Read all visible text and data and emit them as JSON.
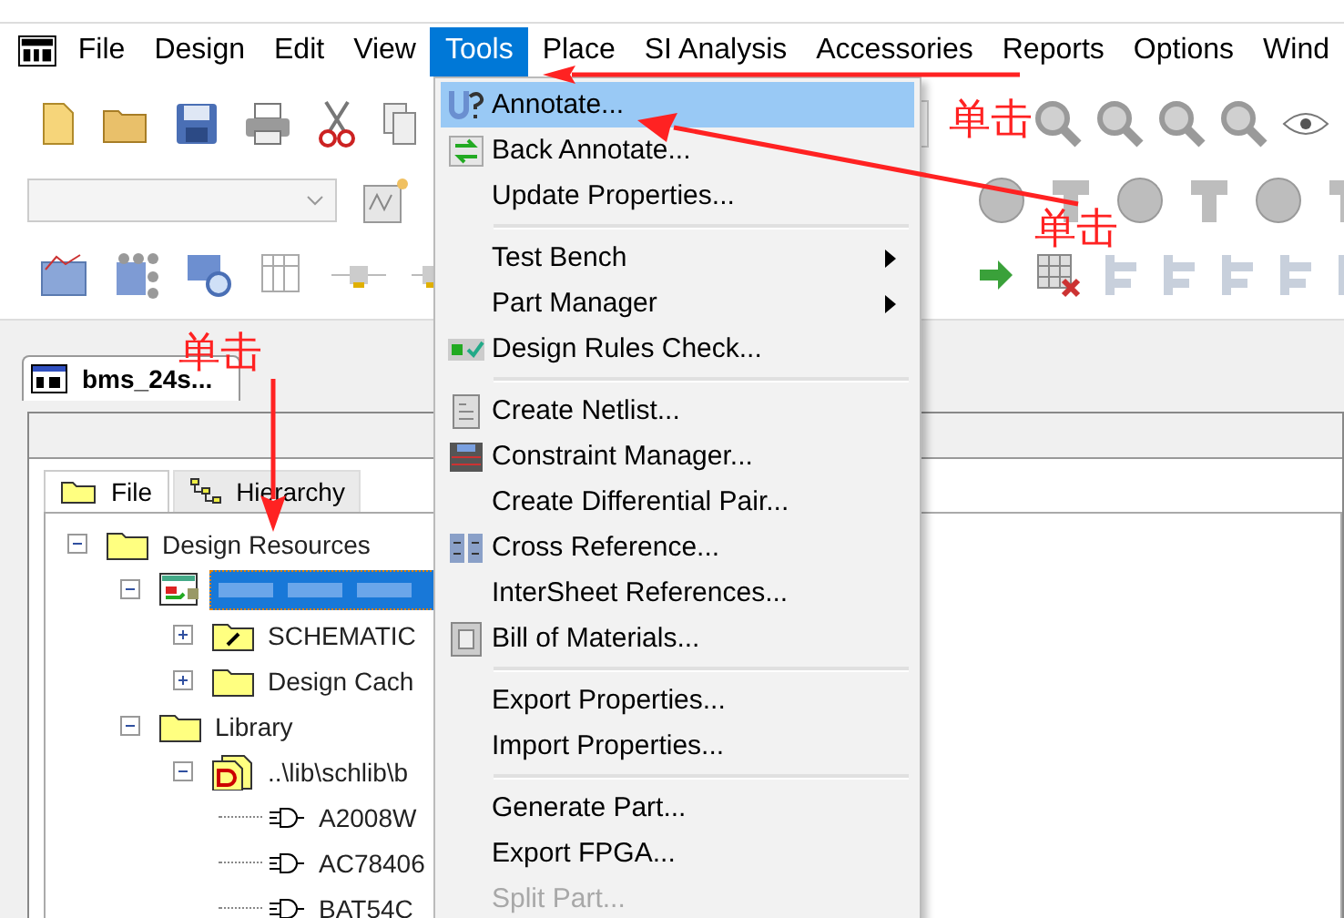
{
  "menu_bar": {
    "items": [
      {
        "label": "File",
        "selected": false
      },
      {
        "label": "Design",
        "selected": false
      },
      {
        "label": "Edit",
        "selected": false
      },
      {
        "label": "View",
        "selected": false
      },
      {
        "label": "Tools",
        "selected": true
      },
      {
        "label": "Place",
        "selected": false
      },
      {
        "label": "SI Analysis",
        "selected": false
      },
      {
        "label": "Accessories",
        "selected": false
      },
      {
        "label": "Reports",
        "selected": false
      },
      {
        "label": "Options",
        "selected": false
      },
      {
        "label": "Wind",
        "selected": false
      }
    ]
  },
  "tools_menu": {
    "items": [
      {
        "kind": "item",
        "label": "Annotate...",
        "selected": true,
        "disabled": false,
        "submenu": false
      },
      {
        "kind": "item",
        "label": "Back Annotate...",
        "selected": false,
        "disabled": false,
        "submenu": false
      },
      {
        "kind": "item",
        "label": "Update Properties...",
        "selected": false,
        "disabled": false,
        "submenu": false
      },
      {
        "kind": "separator"
      },
      {
        "kind": "item",
        "label": "Test Bench",
        "selected": false,
        "disabled": false,
        "submenu": true
      },
      {
        "kind": "item",
        "label": "Part Manager",
        "selected": false,
        "disabled": false,
        "submenu": true
      },
      {
        "kind": "item",
        "label": "Design Rules Check...",
        "selected": false,
        "disabled": false,
        "submenu": false
      },
      {
        "kind": "separator"
      },
      {
        "kind": "item",
        "label": "Create Netlist...",
        "selected": false,
        "disabled": false,
        "submenu": false
      },
      {
        "kind": "item",
        "label": "Constraint Manager...",
        "selected": false,
        "disabled": false,
        "submenu": false
      },
      {
        "kind": "item",
        "label": "Create Differential Pair...",
        "selected": false,
        "disabled": false,
        "submenu": false
      },
      {
        "kind": "item",
        "label": "Cross Reference...",
        "selected": false,
        "disabled": false,
        "submenu": false
      },
      {
        "kind": "item",
        "label": "InterSheet References...",
        "selected": false,
        "disabled": false,
        "submenu": false
      },
      {
        "kind": "item",
        "label": "Bill of Materials...",
        "selected": false,
        "disabled": false,
        "submenu": false
      },
      {
        "kind": "separator"
      },
      {
        "kind": "item",
        "label": "Export Properties...",
        "selected": false,
        "disabled": false,
        "submenu": false
      },
      {
        "kind": "item",
        "label": "Import Properties...",
        "selected": false,
        "disabled": false,
        "submenu": false
      },
      {
        "kind": "separator"
      },
      {
        "kind": "item",
        "label": "Generate Part...",
        "selected": false,
        "disabled": false,
        "submenu": false
      },
      {
        "kind": "item",
        "label": "Export FPGA...",
        "selected": false,
        "disabled": false,
        "submenu": false
      },
      {
        "kind": "item",
        "label": "Split Part...",
        "selected": false,
        "disabled": true,
        "submenu": false
      }
    ]
  },
  "document_tab": {
    "label": "bms_24s..."
  },
  "project_panel": {
    "tabs": [
      {
        "label": "File",
        "selected": true
      },
      {
        "label": "Hierarchy",
        "selected": false
      }
    ],
    "tree": [
      {
        "kind": "folder",
        "label": "Design Resources",
        "expanded": true,
        "selected": false,
        "children": [
          {
            "kind": "design",
            "selected": true,
            "expanded": true,
            "children": [
              {
                "kind": "schematic-folder",
                "label": "SCHEMATIC",
                "expanded": false,
                "selected": false
              },
              {
                "kind": "folder",
                "label": "Design Cach",
                "expanded": false,
                "selected": false
              }
            ]
          },
          {
            "kind": "folder",
            "label": "Library",
            "expanded": true,
            "selected": false,
            "children": [
              {
                "kind": "library",
                "label": "..\\lib\\schlib\\b",
                "expanded": true,
                "selected": false,
                "children": [
                  {
                    "kind": "part",
                    "label": "A2008W",
                    "selected": false
                  },
                  {
                    "kind": "part",
                    "label": "AC78406",
                    "selected": false
                  },
                  {
                    "kind": "part",
                    "label": "BAT54C",
                    "selected": false
                  }
                ]
              }
            ]
          }
        ]
      }
    ]
  },
  "annotations": [
    {
      "text": "单击"
    },
    {
      "text": "单击"
    },
    {
      "text": "单击"
    }
  ]
}
